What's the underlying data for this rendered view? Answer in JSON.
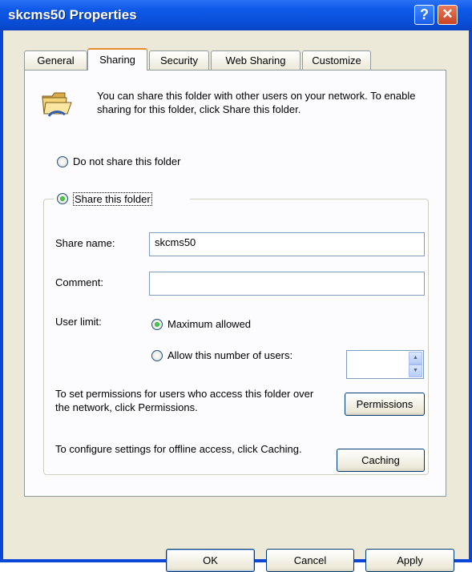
{
  "window": {
    "title": "skcms50 Properties",
    "help_icon": "?",
    "close_icon": "✕"
  },
  "tabs": [
    "General",
    "Sharing",
    "Security",
    "Web Sharing",
    "Customize"
  ],
  "active_tab": "Sharing",
  "info_text": "You can share this folder with other users on your network.  To enable sharing for this folder, click Share this folder.",
  "sharing": {
    "do_not_share_label": "Do not share this folder",
    "share_label": "Share this folder",
    "selected": "share",
    "share_name_label": "Share name:",
    "share_name_value": "skcms50",
    "comment_label": "Comment:",
    "comment_value": "",
    "user_limit_label": "User limit:",
    "max_allowed_label": "Maximum allowed",
    "allow_number_label": "Allow this number of users:",
    "user_limit_selected": "maximum",
    "allow_number_value": "",
    "permissions_text": "To set permissions for users who access this folder over the network, click Permissions.",
    "permissions_button": "Permissions",
    "caching_text": "To configure settings for offline access, click Caching.",
    "caching_button": "Caching"
  },
  "footer": {
    "ok": "OK",
    "cancel": "Cancel",
    "apply": "Apply"
  },
  "colors": {
    "title_bar": "#0a4fd8",
    "dialog_bg": "#ece9d8",
    "tab_highlight": "#e68b2c"
  }
}
